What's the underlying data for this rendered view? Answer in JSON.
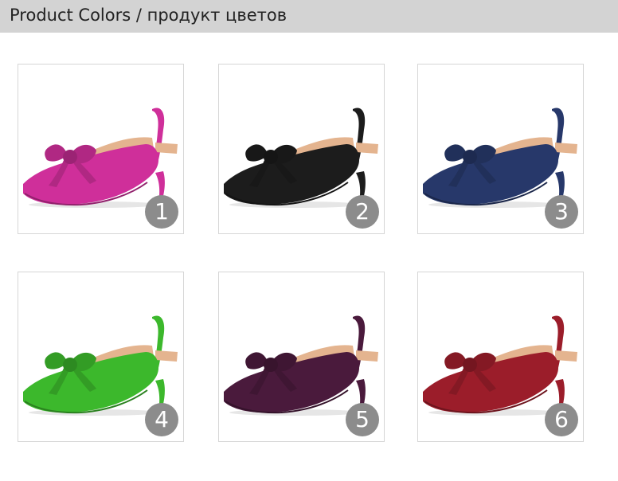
{
  "header": {
    "title": "Product Colors / продукт цветов"
  },
  "products": [
    {
      "number": "1",
      "color": "#cf2f9a",
      "icon": "slingback-pump-icon"
    },
    {
      "number": "2",
      "color": "#1c1c1c",
      "icon": "slingback-pump-icon"
    },
    {
      "number": "3",
      "color": "#27386a",
      "icon": "slingback-pump-icon"
    },
    {
      "number": "4",
      "color": "#3cb82c",
      "icon": "slingback-pump-icon"
    },
    {
      "number": "5",
      "color": "#4a1a3c",
      "icon": "slingback-pump-icon"
    },
    {
      "number": "6",
      "color": "#9b1d2a",
      "icon": "slingback-pump-icon"
    }
  ],
  "skin_color": "#e4b48f"
}
